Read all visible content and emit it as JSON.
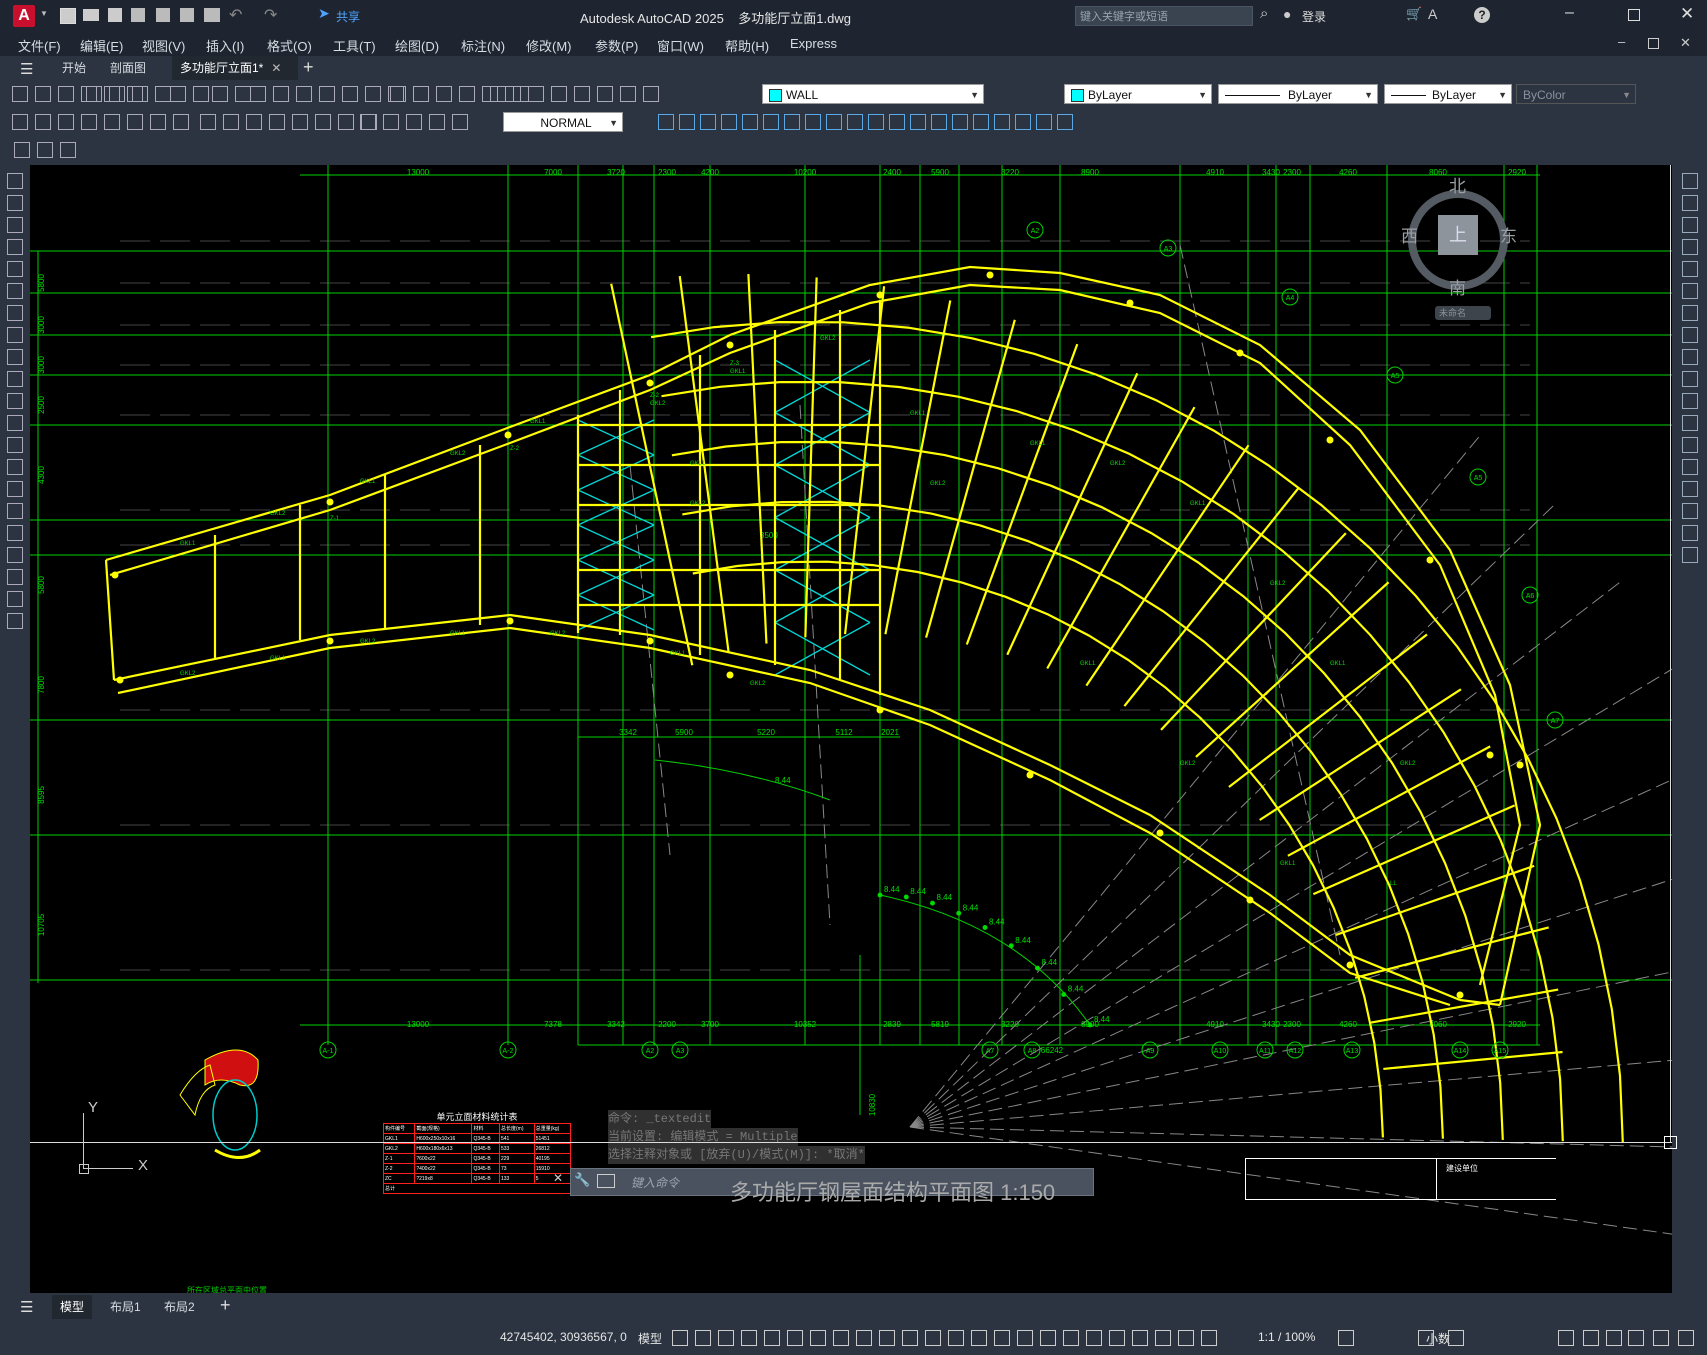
{
  "app": {
    "title": "Autodesk AutoCAD 2025    多功能厅立面1.dwg",
    "share_label": "共享",
    "search_placeholder": "键入关键字或短语",
    "login_label": "登录"
  },
  "menu": [
    "文件(F)",
    "编辑(E)",
    "视图(V)",
    "插入(I)",
    "格式(O)",
    "工具(T)",
    "绘图(D)",
    "标注(N)",
    "修改(M)",
    "参数(P)",
    "窗口(W)",
    "帮助(H)",
    "Express"
  ],
  "tabs": [
    "开始",
    "剖面图",
    "多功能厅立面1*"
  ],
  "toolbar": {
    "layer": "WALL",
    "color": "ByLayer",
    "linetype": "ByLayer",
    "lineweight": "ByLayer",
    "plotstyle": "ByColor",
    "textstyle": "NORMAL"
  },
  "viewcube": {
    "north": "北",
    "south": "南",
    "east": "东",
    "west": "西",
    "top": "上",
    "ucs": "未命名"
  },
  "drawing": {
    "top_dims": [
      "13000",
      "7000",
      "3720",
      "2300",
      "4200",
      "10200",
      "2400",
      "5900",
      "3220",
      "8900",
      "4910",
      "3430",
      "2300",
      "4260",
      "8060",
      "2920"
    ],
    "bottom_dims": [
      "13000",
      "7378",
      "3342",
      "2200",
      "3700",
      "10352",
      "2839",
      "5819",
      "3220",
      "8900",
      "4910",
      "3430",
      "2300",
      "4260",
      "8060",
      "2920"
    ],
    "left_dims": [
      "5800",
      "3000",
      "3000",
      "2500",
      "4300",
      "5800",
      "7800",
      "8595",
      "10705"
    ],
    "axis_bottom": [
      "A-1",
      "A-2",
      "A2",
      "A3",
      "A7",
      "A8",
      "A9",
      "A10",
      "A11",
      "A12",
      "A13",
      "A14",
      "A15"
    ],
    "axis_right": [
      "A2",
      "A3",
      "A4",
      "A5",
      "A5",
      "A6",
      "A7"
    ],
    "mid_dims": [
      "3342",
      "5900",
      "5220",
      "5112",
      "2021"
    ],
    "arc_dims": [
      "8.44",
      "8.44",
      "8.44",
      "8.44",
      "8.44",
      "8.44",
      "8.44",
      "8.44",
      "8.44"
    ],
    "radius_dim": "66242",
    "vertical_dim": "10830",
    "inner_dims": [
      "3500",
      "8.44"
    ],
    "member_labels": [
      "GKL1",
      "GKL2",
      "Z-1",
      "Z-2",
      "Z-3",
      "LL"
    ],
    "table_title": "单元立面材料统计表",
    "table_headers": [
      "构件编号",
      "截面(规格)",
      "材料",
      "总长度(m)",
      "总重量(kg)"
    ],
    "table_rows": [
      [
        "GKL1",
        "H600x250x10x16",
        "Q345-B",
        "541",
        "51451"
      ],
      [
        "GKL2",
        "H600x180x6x13",
        "Q345-B",
        "533",
        "26812"
      ],
      [
        "Z-1",
        "?600x22",
        "Q345-B",
        "229",
        "40195"
      ],
      [
        "Z-2",
        "?400x22",
        "Q345-B",
        "73",
        "15910"
      ],
      [
        "ZC",
        "?219x8",
        "Q345-B",
        "133",
        "5"
      ]
    ],
    "table_total_label": "总计",
    "keyplan_caption": "所在区域总平面中位置",
    "plan_title": "多功能厅钢屋面结构平面图 1:150",
    "ucs_y": "Y",
    "ucs_x": "X",
    "titleblock_label": "建设单位"
  },
  "command": {
    "history": [
      "命令: _textedit",
      "当前设置: 编辑模式 = Multiple",
      "选择注释对象或 [放弃(U)/模式(M)]: *取消*"
    ],
    "placeholder": "键入命令"
  },
  "layout_tabs": [
    "模型",
    "布局1",
    "布局2"
  ],
  "status": {
    "coords": "42745402, 30936567, 0",
    "model": "模型",
    "scale": "1:1 / 100%",
    "units": "小数"
  }
}
